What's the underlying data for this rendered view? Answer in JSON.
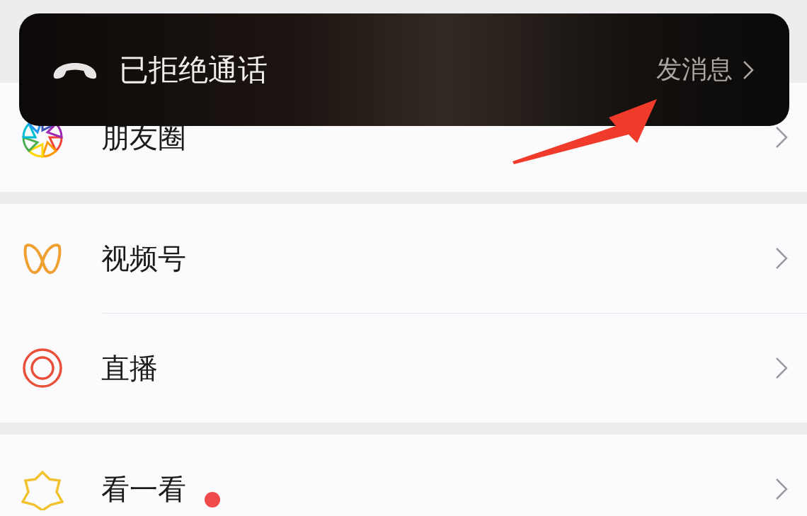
{
  "call_banner": {
    "text": "已拒绝通话",
    "action": "发消息"
  },
  "groups": [
    {
      "items": [
        {
          "kind": "moments",
          "label": "朋友圈",
          "dot": false
        }
      ]
    },
    {
      "items": [
        {
          "kind": "channels",
          "label": "视频号",
          "dot": false
        },
        {
          "kind": "live",
          "label": "直播",
          "dot": false
        }
      ]
    },
    {
      "items": [
        {
          "kind": "lookaround",
          "label": "看一看",
          "dot": true
        }
      ]
    }
  ]
}
